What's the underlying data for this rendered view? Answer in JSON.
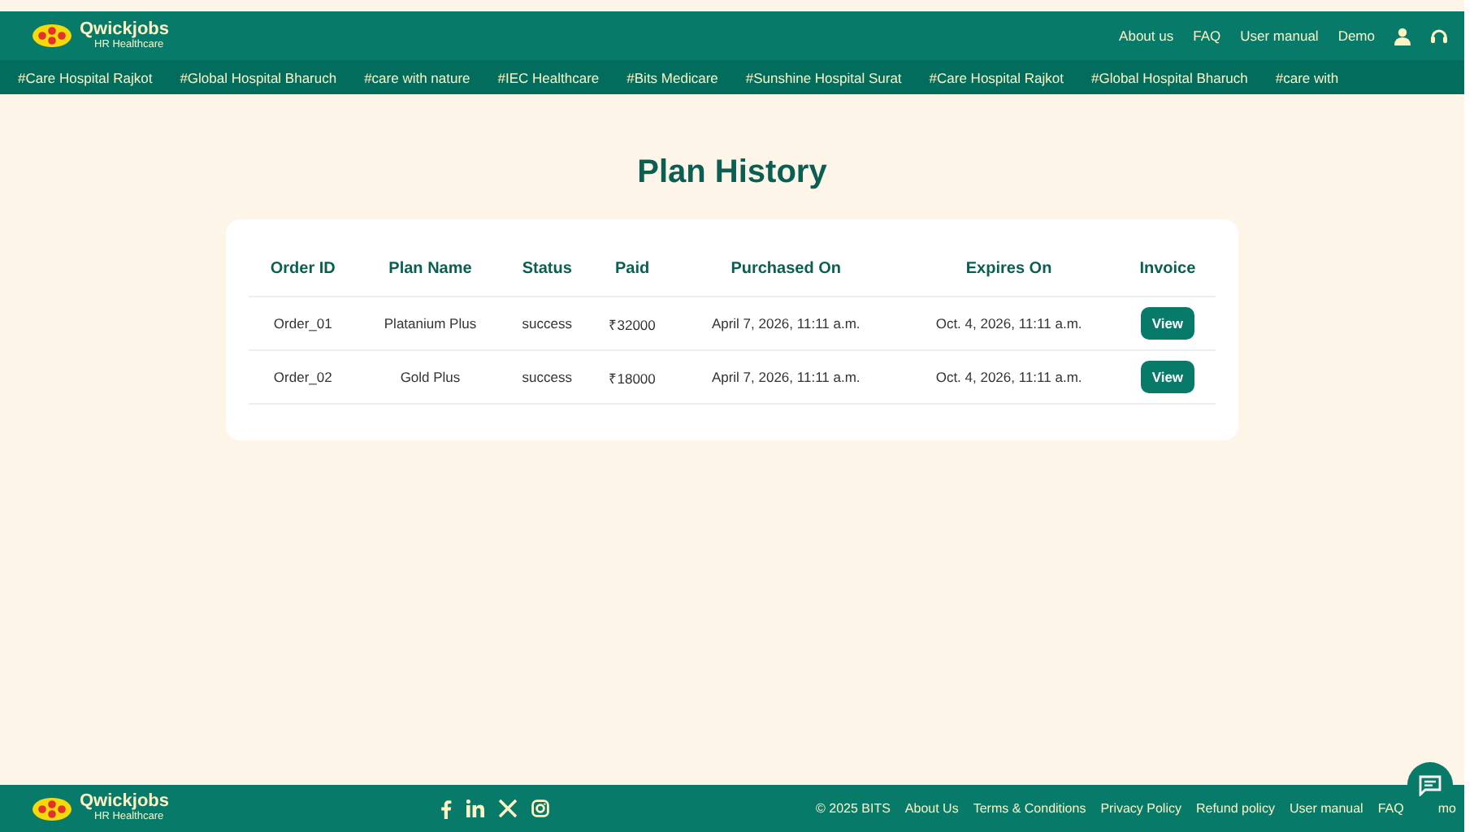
{
  "header": {
    "brand": "Qwickjobs",
    "tagline": "HR Healthcare",
    "nav": [
      "About us",
      "FAQ",
      "User manual",
      "Demo"
    ]
  },
  "ticker": [
    "#Care Hospital Rajkot",
    "#Global Hospital Bharuch",
    "#care with nature",
    "#IEC Healthcare",
    "#Bits Medicare",
    "#Sunshine Hospital Surat",
    "#Care Hospital Rajkot",
    "#Global Hospital Bharuch",
    "#care with"
  ],
  "page_title": "Plan History",
  "table": {
    "columns": [
      "Order ID",
      "Plan Name",
      "Status",
      "Paid",
      "Purchased On",
      "Expires On",
      "Invoice"
    ],
    "rows": [
      {
        "order_id": "Order_01",
        "plan": "Platanium Plus",
        "status": "success",
        "paid": "₹32000",
        "purchased": "April 7, 2026, 11:11 a.m.",
        "expires": "Oct. 4, 2026, 11:11 a.m.",
        "action": "View"
      },
      {
        "order_id": "Order_02",
        "plan": "Gold Plus",
        "status": "success",
        "paid": "₹18000",
        "purchased": "April 7, 2026, 11:11 a.m.",
        "expires": "Oct. 4, 2026, 11:11 a.m.",
        "action": "View"
      }
    ]
  },
  "footer": {
    "brand": "Qwickjobs",
    "tagline": "HR Healthcare",
    "copyright": "© 2025 BITS",
    "links": [
      "About Us",
      "Terms & Conditions",
      "Privacy Policy",
      "Refund policy",
      "User manual",
      "FAQ",
      "mo"
    ]
  }
}
